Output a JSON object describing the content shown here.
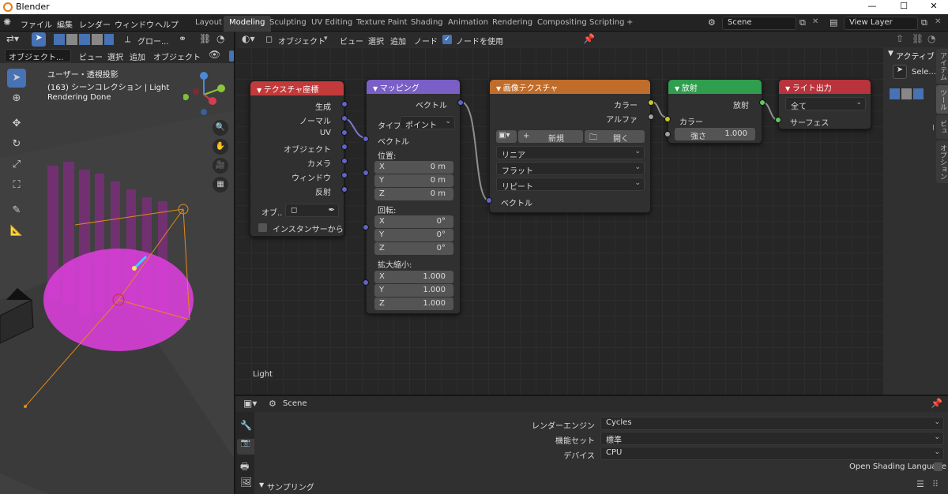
{
  "app": {
    "title": "Blender",
    "minimize": "—",
    "maximize": "☐",
    "close": "✕"
  },
  "menu": [
    "ファイル",
    "編集",
    "レンダー",
    "ウィンドウ",
    "ヘルプ"
  ],
  "workspaces": [
    "Layout",
    "Modeling",
    "Sculpting",
    "UV Editing",
    "Texture Paint",
    "Shading",
    "Animation",
    "Rendering",
    "Compositing",
    "Scripting",
    "+"
  ],
  "scene": {
    "name": "Scene",
    "view_layer": "View Layer"
  },
  "viewport": {
    "mode": "オブジェクト...",
    "menus": [
      "ビュー",
      "選択",
      "追加",
      "オブジェクト"
    ],
    "orient": "グロー...",
    "info1": "ユーザー・透視投影",
    "info2": "(163) シーンコレクション | Light",
    "info3": "Rendering Done"
  },
  "node_editor": {
    "type": "オブジェクト",
    "menus": [
      "ビュー",
      "選択",
      "追加",
      "ノード"
    ],
    "use_nodes": "ノードを使用",
    "label": "Light"
  },
  "nodes": {
    "texcoord": {
      "title": "テクスチャ座標",
      "outputs": [
        "生成",
        "ノーマル",
        "UV",
        "オブジェクト",
        "カメラ",
        "ウィンドウ",
        "反射"
      ],
      "object_label": "オブ..",
      "instancer": "インスタンサーから"
    },
    "mapping": {
      "title": "マッピング",
      "out": "ベクトル",
      "type_label": "タイプ:",
      "type_value": "ポイント",
      "vec": "ベクトル",
      "loc": "位置:",
      "rot": "回転:",
      "scale": "拡大縮小:",
      "loc_vals": [
        [
          "X",
          "0 m"
        ],
        [
          "Y",
          "0 m"
        ],
        [
          "Z",
          "0 m"
        ]
      ],
      "rot_vals": [
        [
          "X",
          "0°"
        ],
        [
          "Y",
          "0°"
        ],
        [
          "Z",
          "0°"
        ]
      ],
      "scale_vals": [
        [
          "X",
          "1.000"
        ],
        [
          "Y",
          "1.000"
        ],
        [
          "Z",
          "1.000"
        ]
      ]
    },
    "image": {
      "title": "画像テクスチャ",
      "out_color": "カラー",
      "out_alpha": "アルファ",
      "new": "新規",
      "open": "開く",
      "interp": "リニア",
      "proj": "フラット",
      "ext": "リピート",
      "vec": "ベクトル"
    },
    "emission": {
      "title": "放射",
      "out": "放射",
      "color": "カラー",
      "strength": "強さ",
      "strength_val": "1.000"
    },
    "output": {
      "title": "ライト出力",
      "target": "全て",
      "surface": "サーフェス"
    }
  },
  "sidebar": {
    "title": "アクティブ",
    "tool": "Sele...",
    "tabs": [
      "アイテム",
      "ツール",
      "ビュー",
      "オプション"
    ]
  },
  "props": {
    "scene": "Scene",
    "rows": [
      [
        "レンダーエンジン",
        "Cycles"
      ],
      [
        "機能セット",
        "標準"
      ],
      [
        "デバイス",
        "CPU"
      ]
    ],
    "osl": "Open Shading Language",
    "sampling": "サンプリング"
  },
  "colors": {
    "texcoord": "#c23a3a",
    "mapping": "#7a5fc6",
    "image": "#c06d2b",
    "emission": "#2f9e4e",
    "output": "#b8333b"
  }
}
